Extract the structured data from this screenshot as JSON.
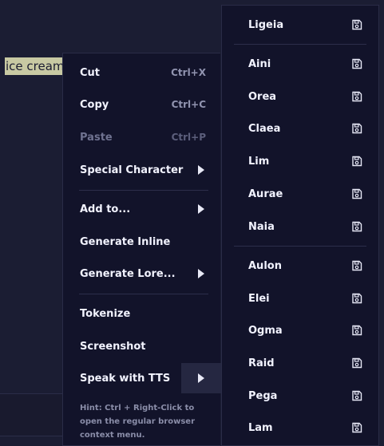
{
  "editor": {
    "selected_text": "ice cream"
  },
  "context_menu": {
    "items": [
      {
        "label": "Cut",
        "shortcut": "Ctrl+X"
      },
      {
        "label": "Copy",
        "shortcut": "Ctrl+C"
      },
      {
        "label": "Paste",
        "shortcut": "Ctrl+P",
        "disabled": true
      },
      {
        "label": "Special Character",
        "submenu": true
      },
      {
        "label": "Add to...",
        "submenu": true
      },
      {
        "label": "Generate Inline"
      },
      {
        "label": "Generate Lore...",
        "submenu": true
      },
      {
        "label": "Tokenize"
      },
      {
        "label": "Screenshot"
      },
      {
        "label": "Speak with TTS",
        "submenu": true,
        "active": true
      }
    ],
    "hint": "Hint: Ctrl + Right-Click to open the regular browser context menu."
  },
  "tts_submenu": {
    "icon": "save-icon",
    "voices": [
      {
        "label": "Ligeia"
      },
      {
        "label": "Aini"
      },
      {
        "label": "Orea"
      },
      {
        "label": "Claea"
      },
      {
        "label": "Lim"
      },
      {
        "label": "Aurae"
      },
      {
        "label": "Naia"
      },
      {
        "label": "Aulon"
      },
      {
        "label": "Elei"
      },
      {
        "label": "Ogma"
      },
      {
        "label": "Raid"
      },
      {
        "label": "Pega"
      },
      {
        "label": "Lam"
      }
    ]
  },
  "colors": {
    "background": "#1b1d33",
    "menu_bg": "#12132a",
    "selection": "#c8c9a3",
    "disabled_text": "#6f7290"
  }
}
